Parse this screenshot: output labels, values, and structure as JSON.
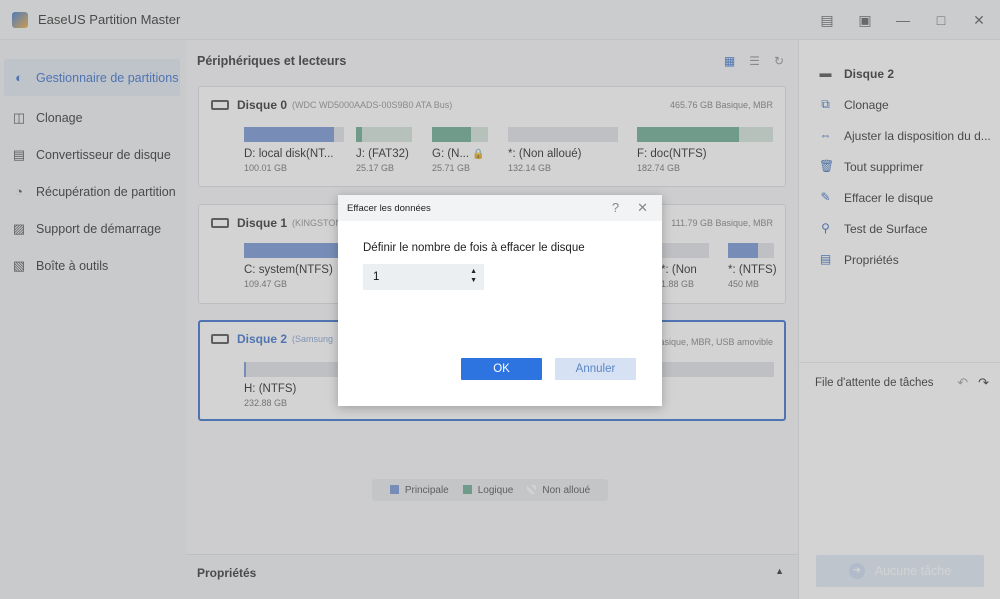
{
  "app": {
    "title": "EaseUS Partition Master"
  },
  "sidebar": {
    "items": [
      {
        "label": "Gestionnaire de partitions",
        "icon": "partition-manager-icon"
      },
      {
        "label": "Clonage",
        "icon": "clone-icon"
      },
      {
        "label": "Convertisseur de disque",
        "icon": "disk-converter-icon"
      },
      {
        "label": "Récupération de partition",
        "icon": "partition-recovery-icon"
      },
      {
        "label": "Support de démarrage",
        "icon": "boot-media-icon"
      },
      {
        "label": "Boîte à outils",
        "icon": "toolbox-icon"
      }
    ]
  },
  "main": {
    "title": "Périphériques et lecteurs",
    "disks": [
      {
        "name": "Disque 0",
        "model": "(WDC WD5000AADS-00S9B0 ATA Bus)",
        "info": "465.76 GB Basique, MBR",
        "partitions": [
          {
            "name": "D: local disk(NT...",
            "size": "100.01 GB",
            "usage": 0.9
          },
          {
            "name": "J: (FAT32)",
            "size": "25.17 GB",
            "usage": 0.1
          },
          {
            "name": "G: (N...",
            "size": "25.71 GB",
            "usage": 0.7
          },
          {
            "name": "*: (Non alloué)",
            "size": "132.14 GB"
          },
          {
            "name": "F: doc(NTFS)",
            "size": "182.74 GB",
            "usage": 0.75
          }
        ]
      },
      {
        "name": "Disque 1",
        "model": "(KINGSTON",
        "info": "111.79 GB Basique, MBR",
        "partitions": [
          {
            "name": "C: system(NTFS)",
            "size": "109.47 GB",
            "usage": 0.85
          },
          {
            "name": "*: (Non",
            "size": "1.88 GB"
          },
          {
            "name": "*: (NTFS)",
            "size": "450 MB",
            "usage": 0.65
          }
        ]
      },
      {
        "name": "Disque 2",
        "model": "(Samsung",
        "info": "Basique, MBR, USB amovible",
        "partitions": [
          {
            "name": "H: (NTFS)",
            "size": "232.88 GB"
          }
        ]
      }
    ],
    "legend": [
      {
        "label": "Principale",
        "color": "#6b8fd3"
      },
      {
        "label": "Logique",
        "color": "#5fa58a"
      },
      {
        "label": "Non alloué",
        "color": "#d4d7db"
      }
    ],
    "properties_label": "Propriétés"
  },
  "rpanel": {
    "disk_label": "Disque 2",
    "actions": [
      {
        "label": "Clonage",
        "icon": "clone-icon"
      },
      {
        "label": "Ajuster la disposition du d...",
        "icon": "adjust-layout-icon"
      },
      {
        "label": "Tout supprimer",
        "icon": "trash-icon"
      },
      {
        "label": "Effacer le disque",
        "icon": "eraser-icon"
      },
      {
        "label": "Test de Surface",
        "icon": "surface-test-icon"
      },
      {
        "label": "Propriétés",
        "icon": "properties-icon"
      }
    ],
    "queue_label": "File d'attente de tâches",
    "execute_label": "Aucune tâche"
  },
  "dialog": {
    "title": "Effacer les données",
    "prompt": "Définir le nombre de fois à effacer le disque",
    "value": "1",
    "ok_label": "OK",
    "cancel_label": "Annuler"
  }
}
